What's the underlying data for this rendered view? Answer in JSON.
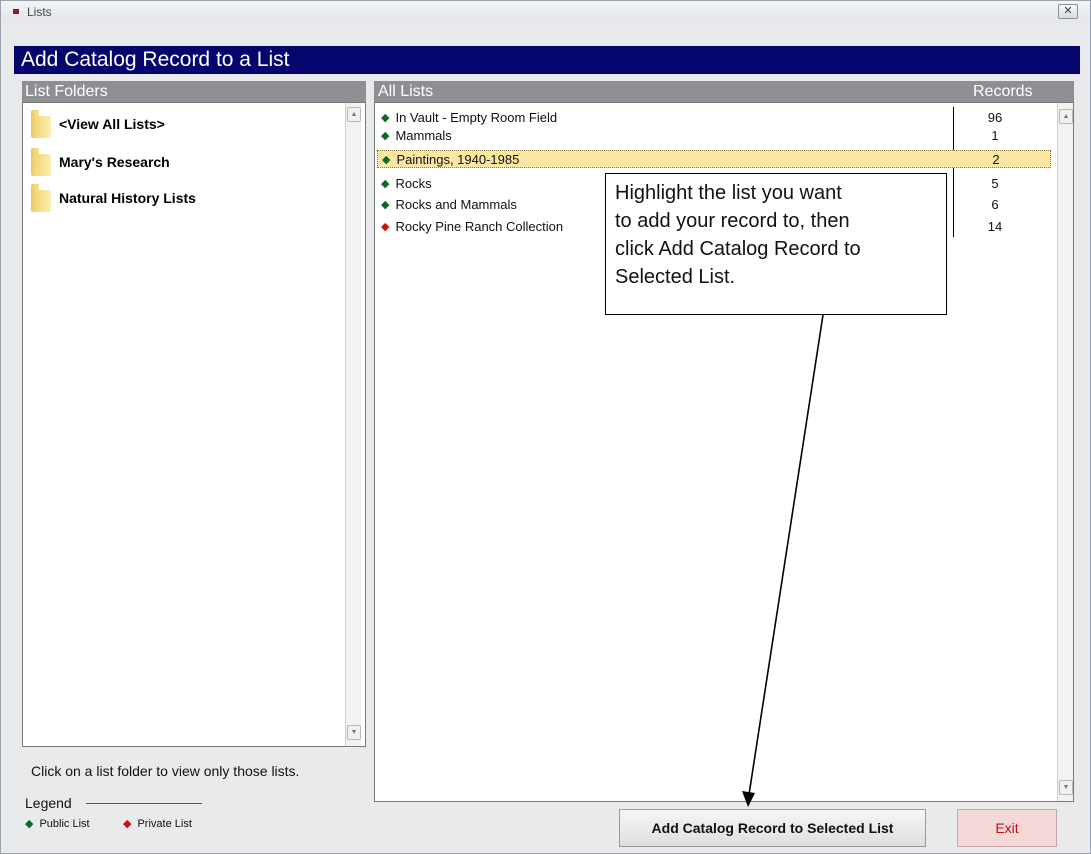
{
  "window": {
    "title": "Lists",
    "close_glyph": "✕"
  },
  "header": {
    "title": "Add Catalog Record to a List"
  },
  "folders": {
    "heading": "List Folders",
    "items": [
      {
        "label": "<View All Lists>"
      },
      {
        "label": "Mary's Research"
      },
      {
        "label": "Natural History Lists"
      }
    ],
    "hint": "Click on a list folder to view only those lists."
  },
  "legend": {
    "title": "Legend",
    "public_label": "Public List",
    "private_label": "Private List",
    "public_color": "#0a6a2a",
    "private_color": "#cc1010"
  },
  "lists": {
    "heading": "All Lists",
    "records_heading": "Records",
    "rows": [
      {
        "name": "In Vault - Empty Room Field",
        "count": "96",
        "type": "public"
      },
      {
        "name": "Mammals",
        "count": "1",
        "type": "public"
      },
      {
        "name": "Paintings, 1940-1985",
        "count": "2",
        "type": "public",
        "selected": true
      },
      {
        "name": "Rocks",
        "count": "5",
        "type": "public"
      },
      {
        "name": "Rocks and Mammals",
        "count": "6",
        "type": "public"
      },
      {
        "name": "Rocky Pine Ranch Collection",
        "count": "14",
        "type": "private"
      }
    ]
  },
  "callout": {
    "lines": [
      "Highlight the list you want",
      "to add your record to, then",
      "click Add Catalog Record to",
      "Selected List."
    ]
  },
  "buttons": {
    "add_label": "Add Catalog Record to Selected List",
    "exit_label": "Exit"
  },
  "icons": {
    "scroll_up": "▲",
    "scroll_down": "▼",
    "diamond": "◆"
  }
}
